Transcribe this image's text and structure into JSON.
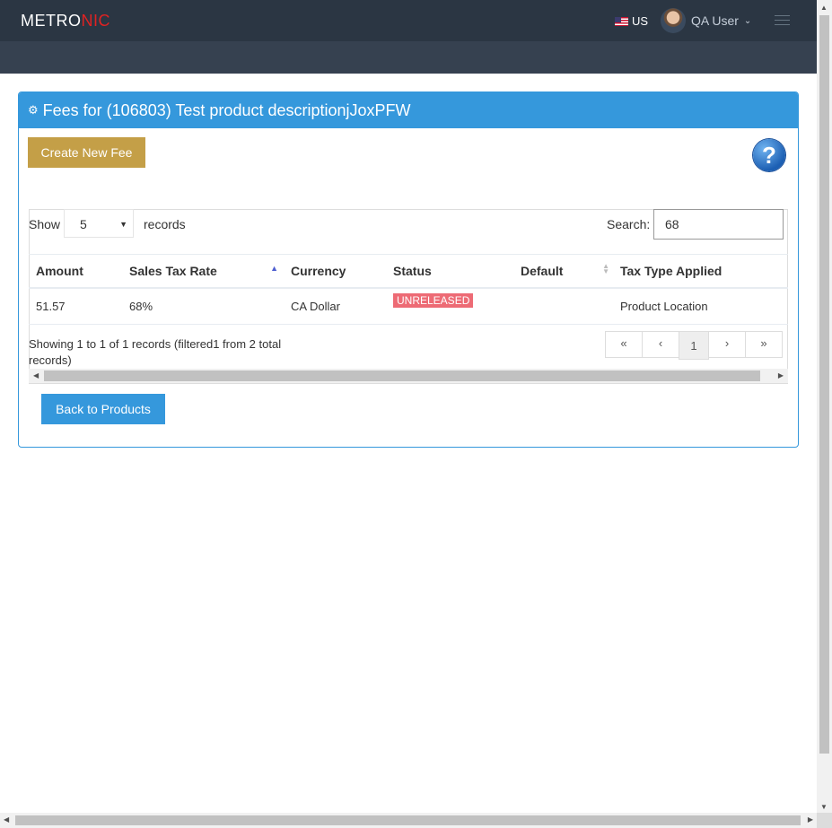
{
  "header": {
    "logo_part1": "METRO",
    "logo_part2": "NIC",
    "language": "US",
    "user_name": "QA User"
  },
  "portlet": {
    "title": "Fees for (106803) Test product descriptionjJoxPFW",
    "create_button": "Create New Fee",
    "help_glyph": "?",
    "back_button": "Back to Products"
  },
  "table_controls": {
    "show_label": "Show",
    "page_size": "5",
    "records_label": "records",
    "search_label": "Search:",
    "search_value": "68"
  },
  "table": {
    "columns": [
      "Amount",
      "Sales Tax Rate",
      "Currency",
      "Status",
      "Default",
      "Tax Type Applied"
    ],
    "rows": [
      {
        "amount": "51.57",
        "sales_tax_rate": "68%",
        "currency": "CA Dollar",
        "status": "UNRELEASED",
        "default": "",
        "tax_type_applied": "Product Location"
      }
    ]
  },
  "footer": {
    "info": "Showing 1 to 1 of 1 records (filtered1 from 2 total records)",
    "pager": [
      "«",
      "‹",
      "1",
      "›",
      "»"
    ],
    "current_page": "1"
  },
  "colors": {
    "header_bg": "#2b3643",
    "accent_blue": "#3598dc",
    "create_button": "#c49f47",
    "status_unreleased": "#ed6b75"
  }
}
